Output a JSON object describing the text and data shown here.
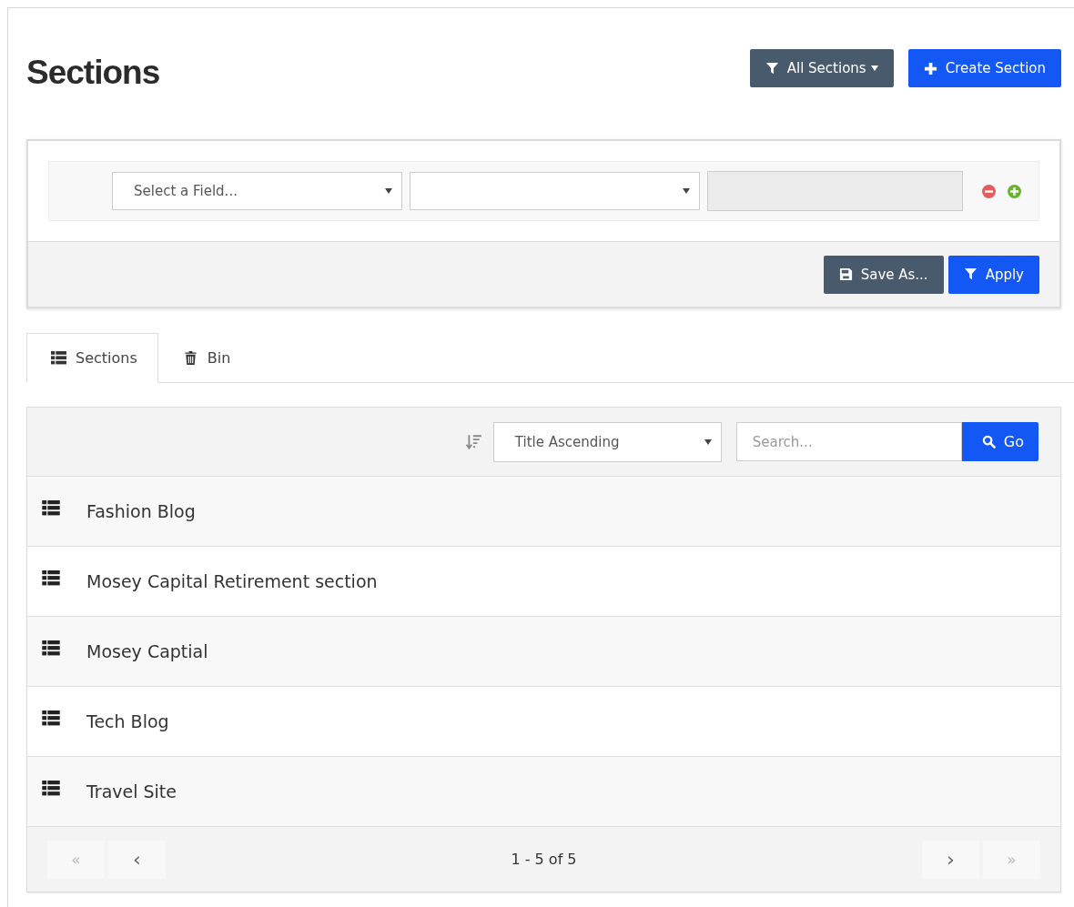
{
  "page": {
    "title": "Sections"
  },
  "header_buttons": [
    {
      "kind": "dropdown",
      "label": "All Sections"
    },
    {
      "kind": "create",
      "label": "Create Section"
    }
  ],
  "filter": {
    "field": {
      "placeholder": "Select a Field..."
    },
    "value": {
      "disabled": true
    },
    "buttons": [
      {
        "kind": "save",
        "label": "Save As..."
      },
      {
        "kind": "apply",
        "label": "Apply"
      }
    ]
  },
  "tabs": [
    {
      "label": "Sections",
      "kind": "items",
      "selected": true
    },
    {
      "label": "Bin",
      "kind": "bin",
      "selected": false
    }
  ],
  "toolbar": {
    "sort": "Title Ascending",
    "search": {
      "placeholder": "Search..."
    },
    "go": "Go"
  },
  "rows": [
    {
      "title": "Fashion Blog"
    },
    {
      "title": "Mosey Capital Retirement section"
    },
    {
      "title": "Mosey Captial"
    },
    {
      "title": "Tech Blog"
    },
    {
      "title": "Travel Site"
    }
  ],
  "pagination": {
    "info": "1 - 5 of 5",
    "left": [
      {
        "label": "«",
        "kind": "jump"
      },
      {
        "label": "‹",
        "kind": "step"
      }
    ],
    "right": [
      {
        "label": "›",
        "kind": "step"
      },
      {
        "label": "»",
        "kind": "jump"
      }
    ]
  }
}
